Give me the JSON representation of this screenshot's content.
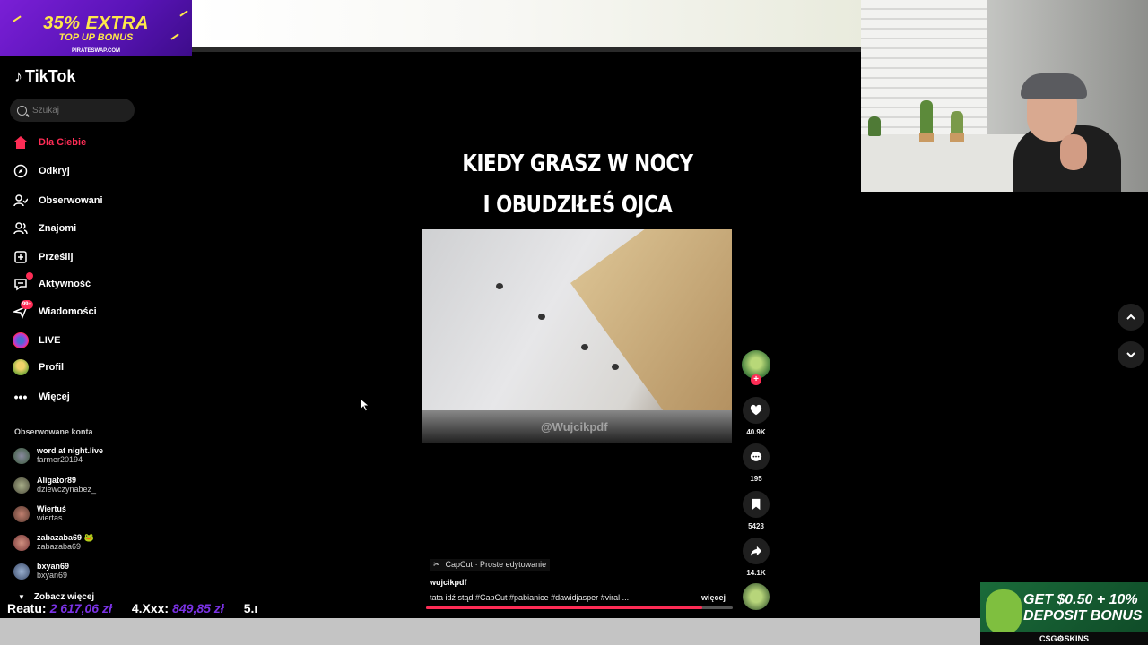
{
  "overlay": {
    "ad_top": {
      "line1": "35% EXTRA",
      "line2": "TOP UP BONUS",
      "domain": "PIRATESWAP.COM"
    },
    "ad_bottom": {
      "line1": "GET $0.50 + 10%",
      "line2": "DEPOSIT BONUS",
      "brand": "CSG⚙SKINS"
    },
    "ticker": {
      "label1": "Reatu:",
      "value1": "2 617,06 zł",
      "label2": "4.Xxx:",
      "value2": "849,85 zł",
      "label3": "5.ı"
    }
  },
  "tiktok": {
    "logo": "TikTok",
    "search": {
      "placeholder": "Szukaj"
    },
    "nav": [
      {
        "label": "Dla Ciebie",
        "icon": "home-icon"
      },
      {
        "label": "Odkryj",
        "icon": "compass-icon"
      },
      {
        "label": "Obserwowani",
        "icon": "following-icon"
      },
      {
        "label": "Znajomi",
        "icon": "friends-icon"
      },
      {
        "label": "Prześlij",
        "icon": "upload-icon"
      },
      {
        "label": "Aktywność",
        "icon": "activity-icon",
        "badge": ""
      },
      {
        "label": "Wiadomości",
        "icon": "messages-icon",
        "badge": "99+"
      },
      {
        "label": "LIVE",
        "icon": "live-icon"
      },
      {
        "label": "Profil",
        "icon": "profile-icon"
      },
      {
        "label": "Więcej",
        "icon": "more-icon"
      }
    ],
    "following_title": "Obserwowane konta",
    "accounts": [
      {
        "name": "word at night.live",
        "handle": "farmer20194"
      },
      {
        "name": "Aligator89",
        "handle": "dziewczynabez_"
      },
      {
        "name": "Wiertuś",
        "handle": "wiertas"
      },
      {
        "name": "zabazaba69 🐸",
        "handle": "zabazaba69"
      },
      {
        "name": "bxyan69",
        "handle": "bxyan69"
      }
    ],
    "see_more": "Zobacz więcej",
    "video": {
      "caption_line1": "KIEDY GRASZ W NOCY",
      "caption_line2": "I OBUDZIŁEŚ OJCA",
      "watermark": "@Wujcikpdf",
      "capcut": "CapCut · Proste edytowanie",
      "author": "wujcikpdf",
      "description": "tata idź stąd #CapCut #pabianice #dawidjasper #viral ...",
      "more": "więcej",
      "progress": 0.9,
      "likes": "40.9K",
      "comments": "195",
      "saves": "5423",
      "shares": "14.1K"
    }
  }
}
